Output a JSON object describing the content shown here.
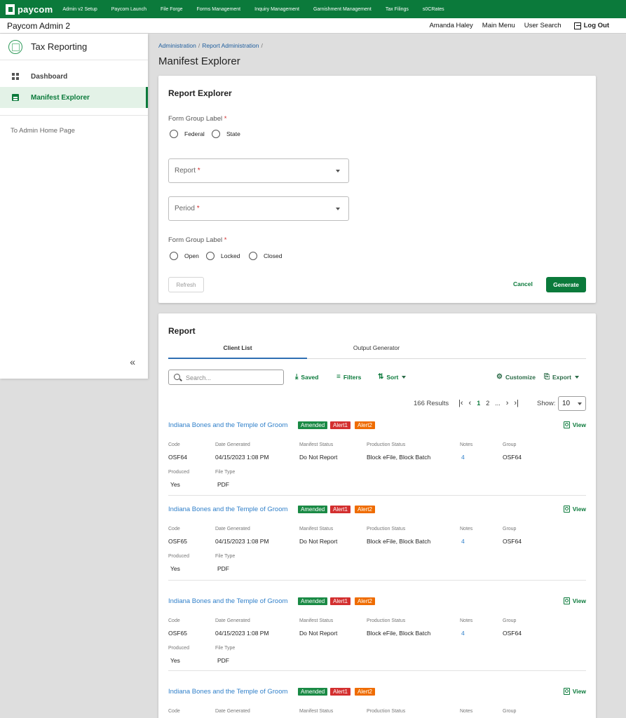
{
  "topbar": {
    "brand": "paycom",
    "nav": [
      "Admin v2 Setup",
      "Paycom Launch",
      "File Forge",
      "Forms Management",
      "Inquiry Management",
      "Garnishment Management",
      "Tax Filings",
      "s0CRates"
    ]
  },
  "appbar": {
    "title": "Paycom Admin 2",
    "user": "Amanda Haley",
    "main_menu": "Main Menu",
    "user_search": "User Search",
    "logout": "Log Out"
  },
  "sidebar": {
    "title": "Tax Reporting",
    "items": [
      {
        "label": "Dashboard",
        "icon": "dashboard-icon"
      },
      {
        "label": "Manifest Explorer",
        "icon": "clipboard-icon",
        "active": true
      }
    ],
    "home_link": "To Admin Home Page",
    "collapse": "«"
  },
  "breadcrumb": {
    "items": [
      "Administration",
      "Report Administration"
    ],
    "sep": "/"
  },
  "page_title": "Manifest Explorer",
  "report_explorer": {
    "title": "Report Explorer",
    "group1_label": "Form Group Label",
    "group1_options": [
      "Federal",
      "State"
    ],
    "report_placeholder": "Report",
    "period_placeholder": "Period",
    "group2_label": "Form Group Label",
    "group2_options": [
      "Open",
      "Locked",
      "Closed"
    ],
    "required_mark": "*",
    "refresh": "Refresh",
    "cancel": "Cancel",
    "generate": "Generate"
  },
  "report": {
    "title": "Report",
    "tabs": [
      "Client List",
      "Output Generator"
    ],
    "search_placeholder": "Search...",
    "saved": "Saved",
    "filters": "Filters",
    "sort": "Sort",
    "customize": "Customize",
    "export": "Export",
    "results": "166 Results",
    "pager": {
      "first": "|‹",
      "prev": "‹",
      "pages": [
        "1",
        "2",
        "..."
      ],
      "next": "›",
      "last": "›|"
    },
    "show_label": "Show:",
    "show_value": "10",
    "field_labels": {
      "code": "Code",
      "date": "Date Generated",
      "manifest": "Manifest Status",
      "production": "Production Status",
      "notes": "Notes",
      "group": "Group",
      "produced": "Produced",
      "filetype": "File Type"
    },
    "view": "View",
    "records": [
      {
        "name": "Indiana Bones and the Temple of Groom",
        "badges": [
          "Amended",
          "Alert1",
          "Alert2"
        ],
        "code": "OSF64",
        "date": "04/15/2023 1:08 PM",
        "manifest": "Do Not Report",
        "production": "Block eFile, Block Batch",
        "notes": "4",
        "group": "OSF64",
        "produced": "Yes",
        "filetype": "PDF"
      },
      {
        "name": "Indiana Bones and the Temple of Groom",
        "badges": [
          "Amended",
          "Alert1",
          "Alert2"
        ],
        "code": "OSF65",
        "date": "04/15/2023 1:08 PM",
        "manifest": "Do Not Report",
        "production": "Block eFile, Block Batch",
        "notes": "4",
        "group": "OSF64",
        "produced": "Yes",
        "filetype": "PDF"
      },
      {
        "name": "Indiana Bones and the Temple of Groom",
        "badges": [
          "Amended",
          "Alert1",
          "Alert2"
        ],
        "code": "OSF65",
        "date": "04/15/2023 1:08 PM",
        "manifest": "Do Not Report",
        "production": "Block eFile, Block Batch",
        "notes": "4",
        "group": "OSF64",
        "produced": "Yes",
        "filetype": "PDF"
      },
      {
        "name": "Indiana Bones and the Temple of Groom",
        "badges": [
          "Amended",
          "Alert1",
          "Alert2"
        ]
      }
    ]
  }
}
